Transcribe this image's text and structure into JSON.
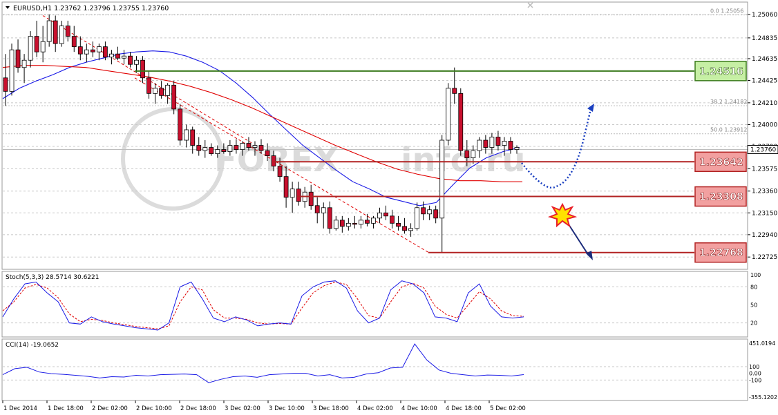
{
  "header": {
    "symbol_line": "EURUSD,H1  1.23762 1.23796 1.23755 1.23760",
    "menu_arrow_icon": "triangle-down-icon",
    "close_icon": "close-icon"
  },
  "watermark": {
    "text": "FOREX",
    "suffix": "info.ru"
  },
  "colors": {
    "bull_candle": "#FFFFFF",
    "bear_candle": "#C8102E",
    "ma_fast": "#1A1AE6",
    "ma_slow": "#E00000",
    "level_green": "#3A7A1C",
    "level_red": "#B22222",
    "label_green_fill": "#C6EFA4",
    "label_red_fill": "#F2A0A0",
    "stoch_main": "#1A1AE6",
    "stoch_signal": "#E00000",
    "cci_line": "#1A1AE6",
    "projection": "#1A3FC0",
    "explosion": "#E8202A"
  },
  "chart_data": [
    {
      "type": "candlestick",
      "symbol": "EURUSD",
      "timeframe": "H1",
      "last_quote": {
        "open": 1.23762,
        "high": 1.23796,
        "low": 1.23755,
        "close": 1.2376
      },
      "ylim": [
        1.2262,
        1.2516
      ],
      "y_ticks": [
        "1.25060",
        "1.24835",
        "1.24635",
        "1.24425",
        "1.24210",
        "1.24000",
        "1.23790",
        "1.23575",
        "1.23360",
        "1.23150",
        "1.22940",
        "1.22725"
      ],
      "y_tick_values": [
        1.2506,
        1.24835,
        1.24635,
        1.24425,
        1.2421,
        1.24,
        1.2379,
        1.23575,
        1.2336,
        1.2315,
        1.2294,
        1.22725
      ],
      "x_ticks": [
        "1 Dec 2014",
        "1 Dec 18:00",
        "2 Dec 02:00",
        "2 Dec 10:00",
        "2 Dec 18:00",
        "3 Dec 02:00",
        "3 Dec 10:00",
        "3 Dec 18:00",
        "4 Dec 02:00",
        "4 Dec 10:00",
        "4 Dec 18:00",
        "5 Dec 02:00"
      ],
      "current_price_label": "1.23760",
      "fibonacci": [
        {
          "label": "0.0  1.25056",
          "value": 1.25056
        },
        {
          "label": "38.2  1.24182",
          "value": 1.24182
        },
        {
          "label": "50.0  1.23912",
          "value": 1.23912
        }
      ],
      "levels": [
        {
          "label": "1.24516",
          "value": 1.24516,
          "kind": "resistance"
        },
        {
          "label": "1.23642",
          "value": 1.23642,
          "kind": "support"
        },
        {
          "label": "1.23308",
          "value": 1.23308,
          "kind": "support"
        },
        {
          "label": "1.22768",
          "value": 1.22768,
          "kind": "target"
        }
      ],
      "candles": [
        [
          1.2445,
          1.2468,
          1.2418,
          1.2432
        ],
        [
          1.2432,
          1.2478,
          1.2428,
          1.2472
        ],
        [
          1.2472,
          1.2482,
          1.245,
          1.2455
        ],
        [
          1.2455,
          1.2468,
          1.244,
          1.2462
        ],
        [
          1.2462,
          1.249,
          1.2455,
          1.2485
        ],
        [
          1.2485,
          1.25,
          1.2465,
          1.247
        ],
        [
          1.247,
          1.2495,
          1.246,
          1.248
        ],
        [
          1.248,
          1.2506,
          1.2475,
          1.25
        ],
        [
          1.25,
          1.2505,
          1.247,
          1.2478
        ],
        [
          1.2478,
          1.25,
          1.2475,
          1.2495
        ],
        [
          1.2495,
          1.25,
          1.248,
          1.2485
        ],
        [
          1.2485,
          1.2495,
          1.247,
          1.2475
        ],
        [
          1.2475,
          1.2485,
          1.2462,
          1.2468
        ],
        [
          1.2468,
          1.2478,
          1.246,
          1.2472
        ],
        [
          1.2472,
          1.248,
          1.2465,
          1.247
        ],
        [
          1.247,
          1.2478,
          1.2462,
          1.2475
        ],
        [
          1.2475,
          1.248,
          1.2462,
          1.2465
        ],
        [
          1.2465,
          1.2472,
          1.2458,
          1.2468
        ],
        [
          1.2468,
          1.2475,
          1.2462,
          1.2464
        ],
        [
          1.2464,
          1.2472,
          1.2458,
          1.2466
        ],
        [
          1.2466,
          1.247,
          1.2455,
          1.2458
        ],
        [
          1.2458,
          1.2466,
          1.245,
          1.2462
        ],
        [
          1.2462,
          1.2466,
          1.244,
          1.2445
        ],
        [
          1.2445,
          1.2452,
          1.2425,
          1.243
        ],
        [
          1.243,
          1.244,
          1.242,
          1.2435
        ],
        [
          1.2435,
          1.2442,
          1.2425,
          1.2428
        ],
        [
          1.2428,
          1.244,
          1.242,
          1.2438
        ],
        [
          1.2438,
          1.2442,
          1.241,
          1.2415
        ],
        [
          1.2415,
          1.242,
          1.238,
          1.2385
        ],
        [
          1.2385,
          1.24,
          1.2378,
          1.2395
        ],
        [
          1.2395,
          1.2398,
          1.2372,
          1.238
        ],
        [
          1.238,
          1.2388,
          1.237,
          1.2375
        ],
        [
          1.2375,
          1.2385,
          1.2368,
          1.2378
        ],
        [
          1.2378,
          1.2382,
          1.237,
          1.2372
        ],
        [
          1.2372,
          1.238,
          1.2368,
          1.2376
        ],
        [
          1.2376,
          1.2382,
          1.2372,
          1.2374
        ],
        [
          1.2374,
          1.2385,
          1.237,
          1.238
        ],
        [
          1.238,
          1.2386,
          1.2372,
          1.2376
        ],
        [
          1.2376,
          1.2384,
          1.237,
          1.2382
        ],
        [
          1.2382,
          1.2388,
          1.2375,
          1.2378
        ],
        [
          1.2378,
          1.2384,
          1.237,
          1.238
        ],
        [
          1.238,
          1.2386,
          1.2372,
          1.2375
        ],
        [
          1.2375,
          1.2382,
          1.2365,
          1.237
        ],
        [
          1.237,
          1.2375,
          1.2355,
          1.236
        ],
        [
          1.236,
          1.2368,
          1.2345,
          1.235
        ],
        [
          1.235,
          1.236,
          1.232,
          1.233
        ],
        [
          1.233,
          1.2345,
          1.2315,
          1.2338
        ],
        [
          1.2338,
          1.2345,
          1.2322,
          1.2326
        ],
        [
          1.2326,
          1.234,
          1.232,
          1.2335
        ],
        [
          1.2335,
          1.2342,
          1.2318,
          1.2322
        ],
        [
          1.2322,
          1.233,
          1.2305,
          1.2315
        ],
        [
          1.2315,
          1.2325,
          1.23,
          1.232
        ],
        [
          1.232,
          1.2326,
          1.2295,
          1.23
        ],
        [
          1.23,
          1.2312,
          1.2298,
          1.2308
        ],
        [
          1.2308,
          1.2312,
          1.2296,
          1.2302
        ],
        [
          1.2302,
          1.231,
          1.2298,
          1.2305
        ],
        [
          1.2305,
          1.2312,
          1.23,
          1.2304
        ],
        [
          1.2304,
          1.2312,
          1.23,
          1.2308
        ],
        [
          1.2308,
          1.2314,
          1.2302,
          1.2305
        ],
        [
          1.2305,
          1.2312,
          1.23,
          1.231
        ],
        [
          1.231,
          1.232,
          1.2305,
          1.2315
        ],
        [
          1.2315,
          1.2322,
          1.2308,
          1.2312
        ],
        [
          1.2312,
          1.2318,
          1.23,
          1.2305
        ],
        [
          1.2305,
          1.2312,
          1.2298,
          1.2302
        ],
        [
          1.2302,
          1.231,
          1.2295,
          1.2298
        ],
        [
          1.2298,
          1.2305,
          1.2292,
          1.23
        ],
        [
          1.23,
          1.2325,
          1.2298,
          1.232
        ],
        [
          1.232,
          1.2326,
          1.2308,
          1.2314
        ],
        [
          1.2314,
          1.2322,
          1.2308,
          1.2318
        ],
        [
          1.2318,
          1.2322,
          1.2305,
          1.231
        ],
        [
          1.231,
          1.239,
          1.2277,
          1.2385
        ],
        [
          1.2385,
          1.244,
          1.238,
          1.2435
        ],
        [
          1.2435,
          1.2455,
          1.242,
          1.243
        ],
        [
          1.243,
          1.2435,
          1.237,
          1.2375
        ],
        [
          1.2375,
          1.2385,
          1.236,
          1.2368
        ],
        [
          1.2368,
          1.238,
          1.2362,
          1.2375
        ],
        [
          1.2375,
          1.2388,
          1.2368,
          1.2385
        ],
        [
          1.2385,
          1.239,
          1.2372,
          1.2378
        ],
        [
          1.2378,
          1.2392,
          1.2372,
          1.2388
        ],
        [
          1.2388,
          1.2394,
          1.2375,
          1.238
        ],
        [
          1.238,
          1.2388,
          1.237,
          1.2384
        ],
        [
          1.2384,
          1.2388,
          1.2372,
          1.2376
        ],
        [
          1.2376,
          1.238,
          1.2372,
          1.2378
        ]
      ],
      "ma_fast": [
        1.2425,
        1.2435,
        1.2442,
        1.2448,
        1.2455,
        1.246,
        1.2464,
        1.2468,
        1.247,
        1.2471,
        1.247,
        1.2466,
        1.246,
        1.2452,
        1.244,
        1.2426,
        1.241,
        1.2395,
        1.238,
        1.2368,
        1.2356,
        1.2345,
        1.2338,
        1.233,
        1.2326,
        1.2322,
        1.2325,
        1.2342,
        1.2358,
        1.2368,
        1.2374,
        1.2378
      ],
      "ma_slow": [
        1.2455,
        1.2457,
        1.2457,
        1.2456,
        1.2455,
        1.2452,
        1.2449,
        1.2446,
        1.2442,
        1.2437,
        1.2431,
        1.2424,
        1.2416,
        1.2407,
        1.2398,
        1.2389,
        1.238,
        1.2372,
        1.2364,
        1.2357,
        1.2352,
        1.2348,
        1.2346,
        1.2346,
        1.2345,
        1.2345
      ]
    },
    {
      "type": "line",
      "title": "Stoch(5,3,3) 28.5714 30.6221",
      "ylim": [
        0,
        100
      ],
      "y_ticks": [
        "100",
        "80",
        "50",
        "20",
        "0"
      ],
      "y_tick_values": [
        100,
        80,
        50,
        20,
        0
      ],
      "series": [
        {
          "name": "Main",
          "values": [
            30,
            60,
            85,
            88,
            70,
            55,
            20,
            18,
            30,
            22,
            18,
            15,
            12,
            10,
            8,
            20,
            80,
            88,
            60,
            28,
            22,
            30,
            25,
            15,
            18,
            20,
            18,
            65,
            80,
            88,
            90,
            78,
            40,
            20,
            28,
            75,
            90,
            85,
            70,
            30,
            28,
            22,
            70,
            85,
            48,
            30,
            28,
            30
          ]
        },
        {
          "name": "Signal",
          "values": [
            40,
            55,
            78,
            84,
            78,
            62,
            35,
            22,
            26,
            24,
            20,
            17,
            14,
            12,
            10,
            15,
            55,
            80,
            75,
            42,
            28,
            28,
            26,
            20,
            18,
            19,
            18,
            45,
            70,
            82,
            88,
            84,
            60,
            32,
            28,
            55,
            80,
            86,
            78,
            48,
            34,
            28,
            50,
            72,
            60,
            40,
            32,
            31
          ]
        }
      ]
    },
    {
      "type": "line",
      "title": "CCI(14) -19.0652",
      "ylim": [
        -355.1202,
        451.0194
      ],
      "y_ticks": [
        "451.0194",
        "100",
        "0.00",
        "-100",
        "-355.1202"
      ],
      "y_tick_values": [
        451.0194,
        100,
        0,
        -100,
        -355.1202
      ],
      "series": [
        {
          "name": "CCI(14)",
          "values": [
            -20,
            70,
            90,
            20,
            -5,
            -15,
            -30,
            -45,
            -70,
            -50,
            -55,
            -30,
            -40,
            -20,
            -15,
            -10,
            -20,
            -140,
            -90,
            -50,
            -40,
            -60,
            -20,
            -10,
            0,
            0,
            -40,
            -20,
            -70,
            -60,
            -10,
            10,
            80,
            90,
            440,
            200,
            50,
            0,
            -20,
            -40,
            -25,
            -30,
            -40,
            -19
          ]
        }
      ]
    }
  ]
}
